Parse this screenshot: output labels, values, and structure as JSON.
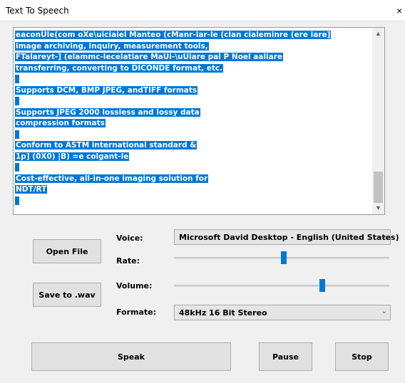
{
  "window": {
    "title": "Text To Speech",
    "close_glyph": "×"
  },
  "text": {
    "lines": [
      "eaconUle(com oXe\\uiciaiel Manteo (cManr-lar-le (clan cialeminre (ere iare]",
      "image archiving, inquiry, measurement tools,",
      "FTalareyt-] (elammc-lecelatiare MaUi-\\uUiare pal P Noel aaliare",
      "transferring, converting to DICONDE format, etc.",
      "",
      "Supports DCM, BMP JPEG, andTIFF formats",
      "",
      "Supports JPEG 2000 lossless and lossy data",
      "compression formats",
      "",
      "Conform to ASTM international standard &",
      "1p] (0X0) |B) =e colgant-le",
      "",
      "Cost-effective, all-in-one imaging solution for",
      "NDT/RT",
      ""
    ],
    "scroll_position": 0.78
  },
  "controls": {
    "open_file": "Open File",
    "save_wav": "Save to .wav",
    "voice_label": "Voice:",
    "voice_value": "Microsoft David Desktop - English (United States)",
    "rate_label": "Rate:",
    "rate_value": 0.51,
    "volume_label": "Volume:",
    "volume_value": 0.69,
    "format_label": "Formate:",
    "format_value": "48kHz 16 Bit Stereo",
    "speak": "Speak",
    "pause": "Pause",
    "stop": "Stop"
  },
  "colors": {
    "selection": "#0078d7",
    "slider_thumb": "#0078d7"
  },
  "icons": {
    "combo_arrow": "chevron-down-icon",
    "scroll_up": "chevron-up-icon",
    "scroll_down": "chevron-down-icon",
    "close": "close-icon"
  }
}
